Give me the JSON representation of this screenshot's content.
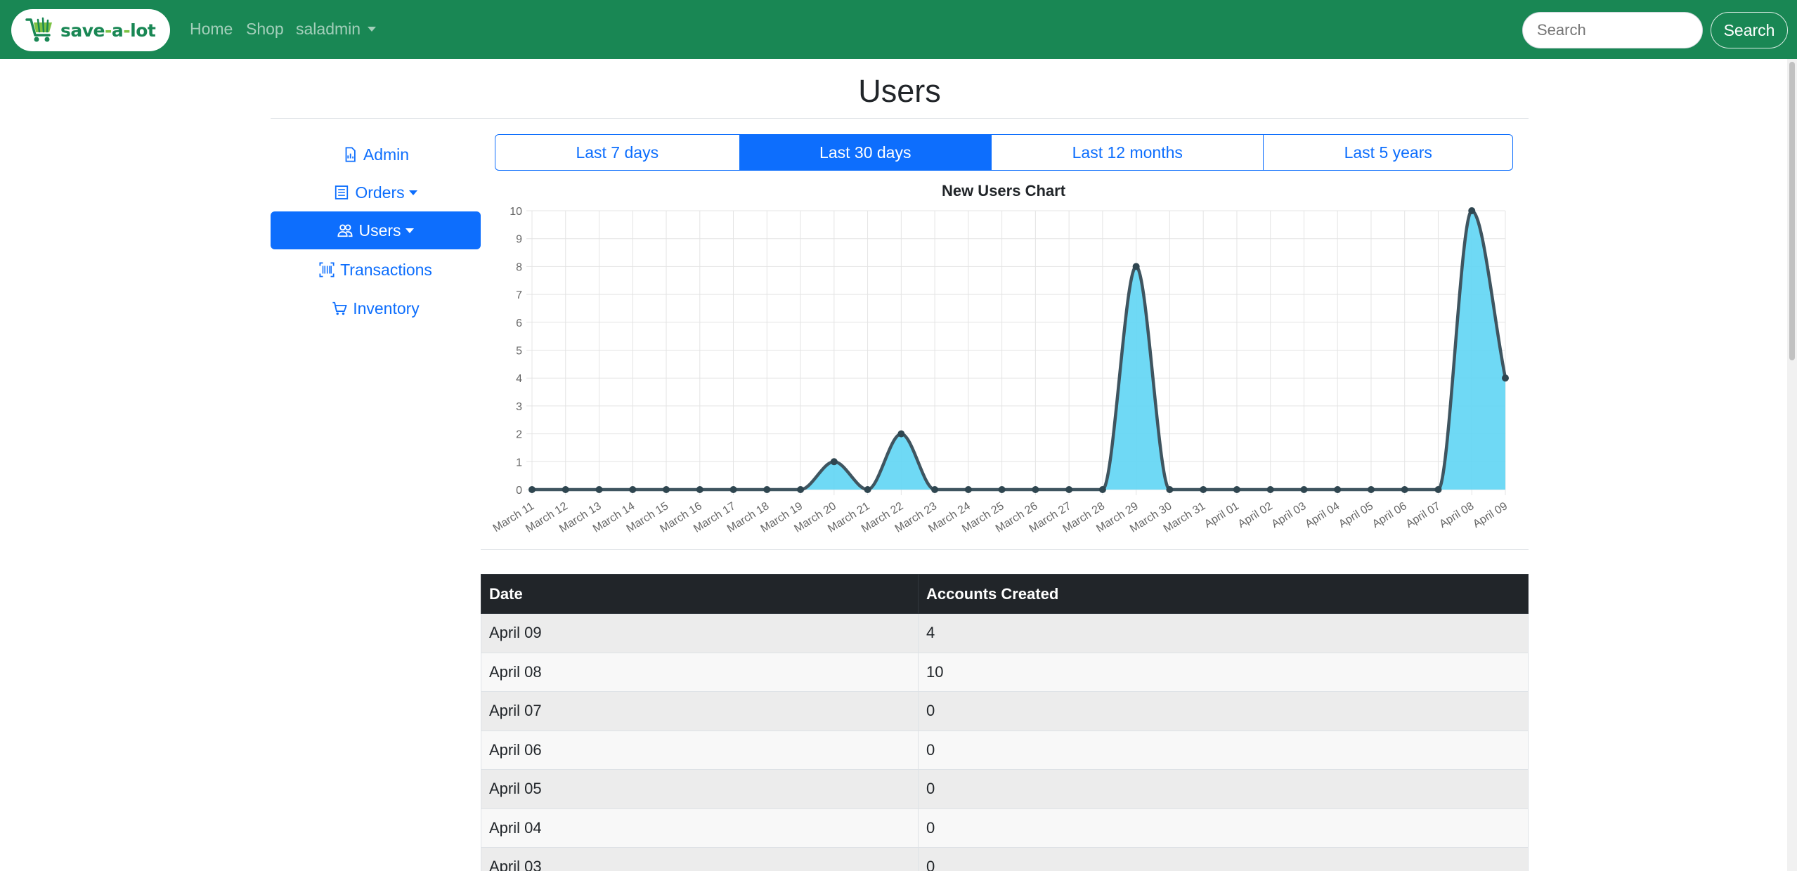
{
  "navbar": {
    "brand": {
      "text_before": "save",
      "dash1": "-",
      "text_mid": "a",
      "dash2": "-",
      "text_after": "lot"
    },
    "links": {
      "home": "Home",
      "shop": "Shop",
      "user": "saladmin"
    },
    "search": {
      "placeholder": "Search",
      "button": "Search"
    }
  },
  "page": {
    "title": "Users"
  },
  "sidebar": {
    "items": [
      {
        "label": "Admin",
        "icon": "file-chart-icon"
      },
      {
        "label": "Orders",
        "icon": "receipt-icon"
      },
      {
        "label": "Users",
        "icon": "users-icon"
      },
      {
        "label": "Transactions",
        "icon": "barcode-scan-icon"
      },
      {
        "label": "Inventory",
        "icon": "cart-icon"
      }
    ]
  },
  "ranges": {
    "items": [
      "Last 7 days",
      "Last 30 days",
      "Last 12 months",
      "Last 5 years"
    ],
    "active": "Last 30 days"
  },
  "colors": {
    "navbar": "#198754",
    "primary": "#0d6efd",
    "fill": "#5fd5f4",
    "line": "#3f5560"
  },
  "chart_data": {
    "type": "area",
    "title": "New Users Chart",
    "x": [
      "March 11",
      "March 12",
      "March 13",
      "March 14",
      "March 15",
      "March 16",
      "March 17",
      "March 18",
      "March 19",
      "March 20",
      "March 21",
      "March 22",
      "March 23",
      "March 24",
      "March 25",
      "March 26",
      "March 27",
      "March 28",
      "March 29",
      "March 30",
      "March 31",
      "April 01",
      "April 02",
      "April 03",
      "April 04",
      "April 05",
      "April 06",
      "April 07",
      "April 08",
      "April 09"
    ],
    "series": [
      {
        "values": [
          0,
          0,
          0,
          0,
          0,
          0,
          0,
          0,
          0,
          1,
          0,
          2,
          0,
          0,
          0,
          0,
          0,
          0,
          8,
          0,
          0,
          0,
          0,
          0,
          0,
          0,
          0,
          0,
          10,
          4
        ]
      }
    ],
    "ylim": [
      0,
      10
    ],
    "yticks": [
      0,
      1,
      2,
      3,
      4,
      5,
      6,
      7,
      8,
      9,
      10
    ],
    "grid": true,
    "legend": "none"
  },
  "table": {
    "headers": [
      "Date",
      "Accounts Created"
    ],
    "rows": [
      [
        "April 09",
        "4"
      ],
      [
        "April 08",
        "10"
      ],
      [
        "April 07",
        "0"
      ],
      [
        "April 06",
        "0"
      ],
      [
        "April 05",
        "0"
      ],
      [
        "April 04",
        "0"
      ],
      [
        "April 03",
        "0"
      ]
    ]
  }
}
